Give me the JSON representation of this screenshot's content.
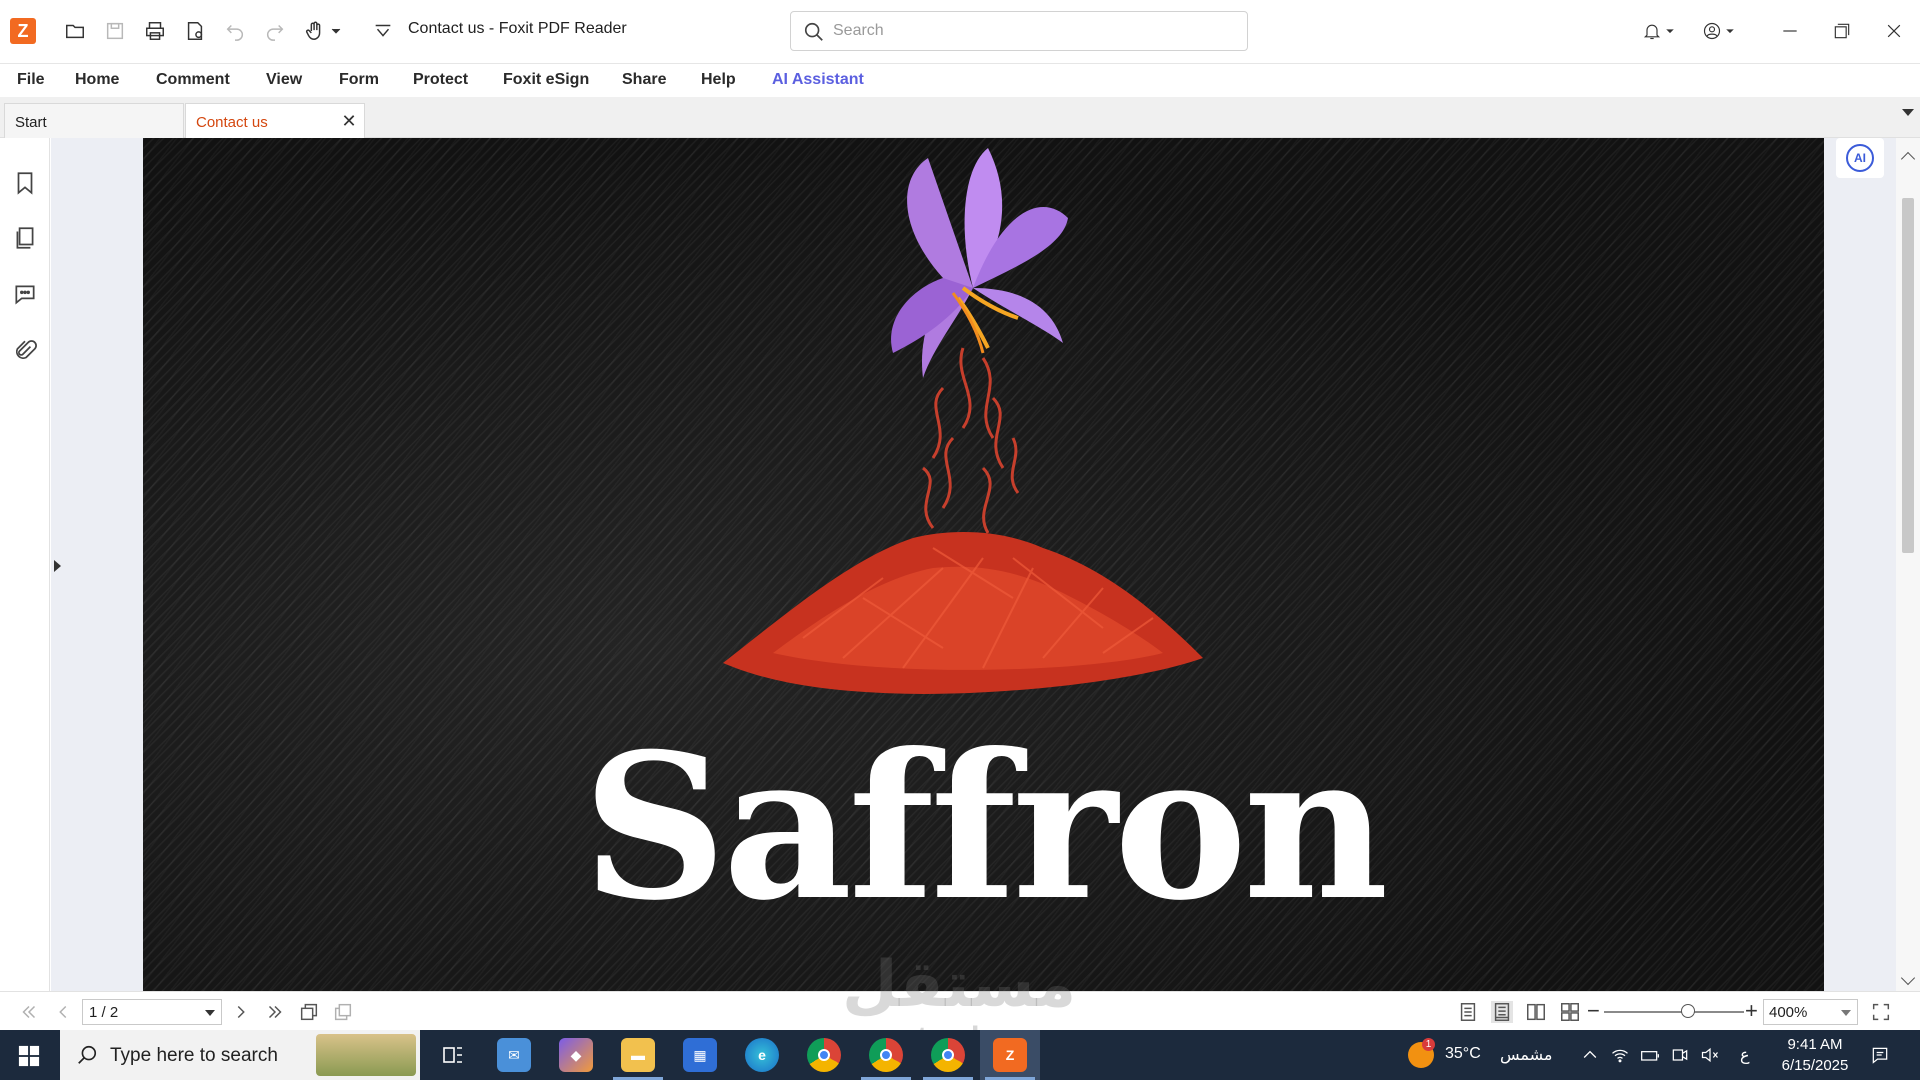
{
  "app": {
    "window_title": "Contact us - Foxit PDF Reader",
    "logo_glyph": "Z"
  },
  "search": {
    "placeholder": "Search"
  },
  "menu": {
    "items": [
      "File",
      "Home",
      "Comment",
      "View",
      "Form",
      "Protect",
      "Foxit eSign",
      "Share",
      "Help",
      "AI Assistant"
    ]
  },
  "tabs": [
    {
      "label": "Start",
      "active": false
    },
    {
      "label": "Contact us",
      "active": true
    }
  ],
  "left_panel": {
    "icons": [
      "bookmark-icon",
      "pages-icon",
      "comments-icon",
      "attachment-icon"
    ]
  },
  "document": {
    "title_text": "Saffron"
  },
  "right_panel": {
    "ai_badge": "AI"
  },
  "statusbar": {
    "page_indicator": "1 / 2",
    "zoom_level": "400%",
    "zoom_slider_fraction": 0.6
  },
  "taskbar": {
    "search_text": "Type here to search",
    "weather": "35°C",
    "weather_label": "مشمس",
    "weather_badge": "1",
    "lang": "ع",
    "time": "9:41 AM",
    "date": "6/15/2025"
  },
  "watermark": {
    "text": "مستقل",
    "sub": "mostaql.com"
  },
  "colors": {
    "accent": "#f26a21",
    "tab_active_text": "#d4470f",
    "ai_menu": "#5b5fe0",
    "taskbar": "#1c2a3d"
  }
}
